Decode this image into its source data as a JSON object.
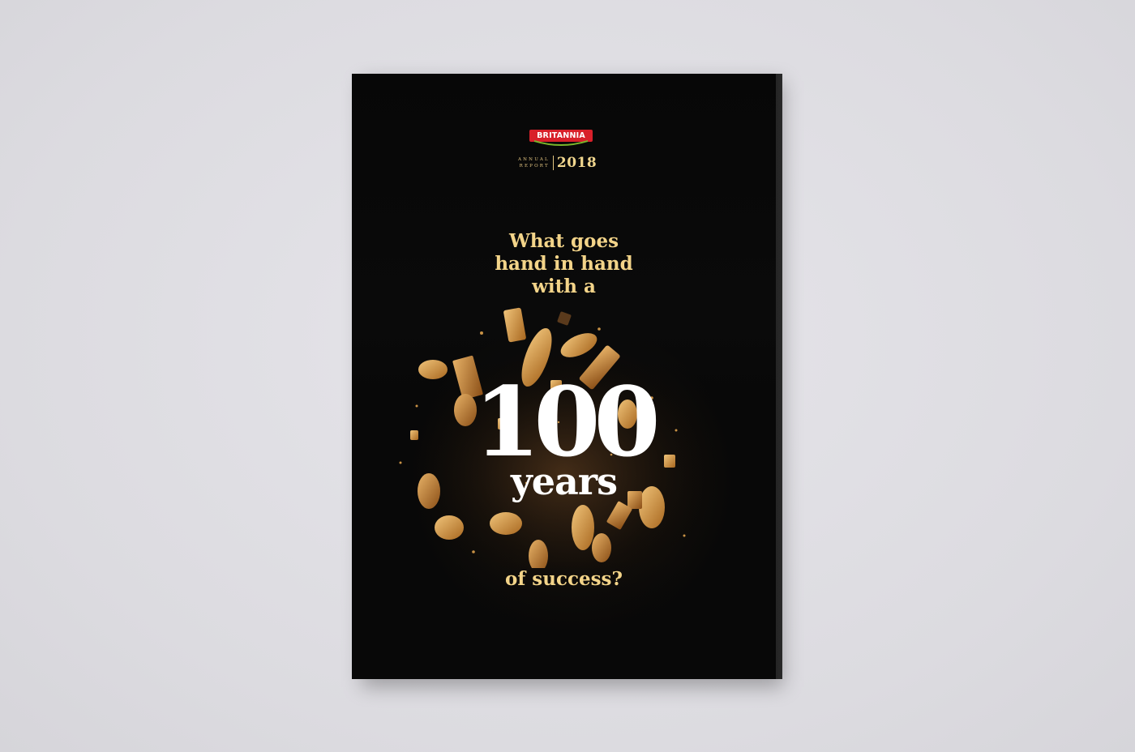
{
  "cover": {
    "brand": "BRITANNIA",
    "report_label_top": "ANNUAL",
    "report_label_bottom": "REPORT",
    "report_year": "2018",
    "headline_lines": [
      "What goes",
      "hand in hand",
      "with a"
    ],
    "big_number": "100",
    "big_word": "years",
    "tagline": "of success?"
  },
  "colors": {
    "background": "#dedde2",
    "cover": "#0a0a0a",
    "headline_gold": "#f3d489",
    "numeral_white": "#ffffff",
    "brand_red": "#d8202a",
    "brand_green": "#7bb52b"
  },
  "icons": {
    "brand_logo": "britannia-logo",
    "biscuit_burst": "biscuit-burst-illustration"
  }
}
